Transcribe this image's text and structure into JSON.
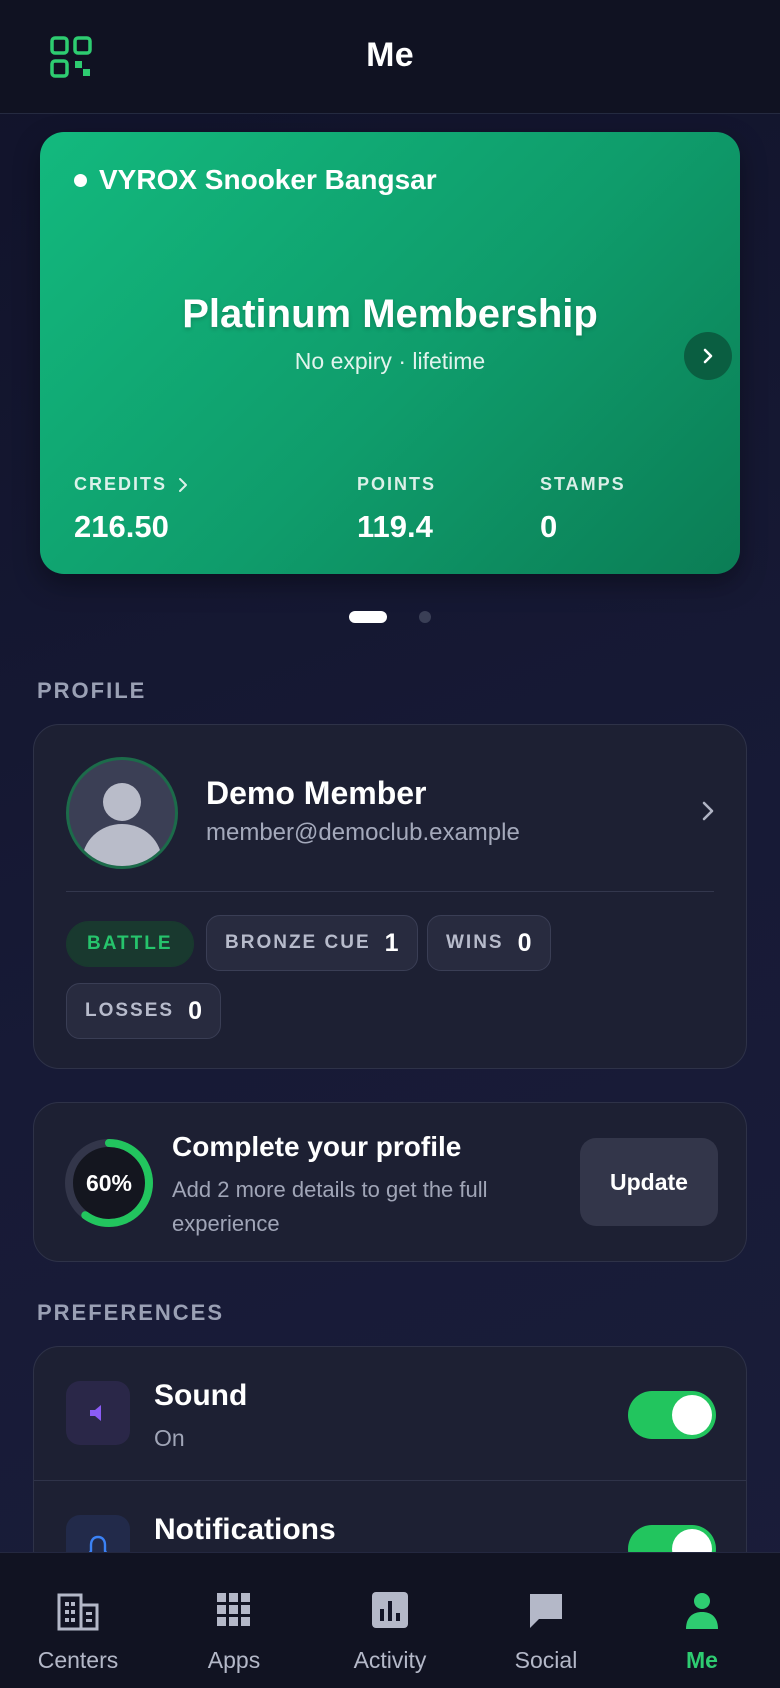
{
  "header": {
    "title": "Me"
  },
  "membership": {
    "venue": "VYROX Snooker Bangsar",
    "tier": "Platinum Membership",
    "expiry": "No expiry · lifetime",
    "stats": {
      "credits_label": "CREDITS",
      "credits_value": "216.50",
      "points_label": "POINTS",
      "points_value": "119.4",
      "stamps_label": "STAMPS",
      "stamps_value": "0"
    },
    "pager": {
      "current_page": 1,
      "total_pages": 2
    }
  },
  "profile_section": {
    "label": "PROFILE",
    "name": "Demo Member",
    "email": "member@democlub.example",
    "chips": {
      "battle": "BATTLE",
      "bronze_cue_label": "BRONZE CUE",
      "bronze_cue_value": "1",
      "wins_label": "WINS",
      "wins_value": "0",
      "losses_label": "LOSSES",
      "losses_value": "0"
    }
  },
  "complete_profile": {
    "percent_text": "60%",
    "percent": 0.6,
    "title": "Complete your profile",
    "description": "Add 2 more details to get the full experience",
    "button": "Update"
  },
  "preferences": {
    "label": "PREFERENCES",
    "sound": {
      "title": "Sound",
      "status": "On",
      "enabled": true
    },
    "notifications": {
      "title": "Notifications",
      "enabled": true
    }
  },
  "tabs": [
    {
      "label": "Centers",
      "icon": "building-icon"
    },
    {
      "label": "Apps",
      "icon": "grid-icon"
    },
    {
      "label": "Activity",
      "icon": "chart-icon"
    },
    {
      "label": "Social",
      "icon": "chat-icon"
    },
    {
      "label": "Me",
      "icon": "person-icon",
      "active": true
    }
  ],
  "colors": {
    "accent": "#22c55e",
    "card_start": "#13b97e",
    "card_end": "#0b7d55",
    "background": "#131528"
  }
}
